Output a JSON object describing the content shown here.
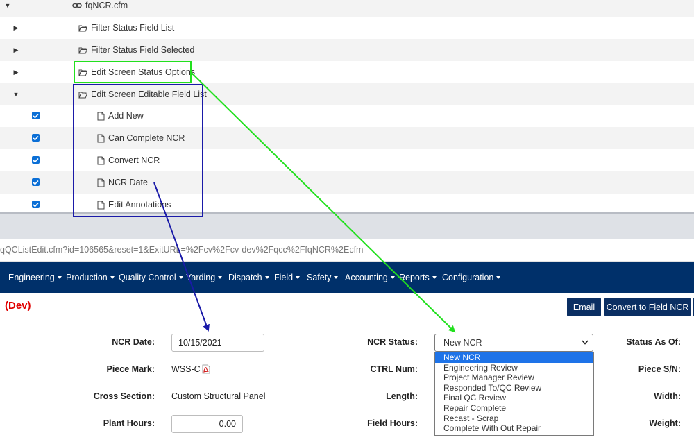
{
  "tree": {
    "root": {
      "label": "fqNCR.cfm",
      "icon": "link-icon"
    },
    "folders": [
      {
        "label": "Filter Status Field List",
        "icon": "folder-open-icon",
        "expanded": false
      },
      {
        "label": "Filter Status Field Selected",
        "icon": "folder-open-icon",
        "expanded": false
      },
      {
        "label": "Edit Screen Status Options",
        "icon": "folder-open-icon",
        "expanded": false
      },
      {
        "label": "Edit Screen Editable Field List",
        "icon": "folder-open-icon",
        "expanded": true
      }
    ],
    "files": [
      {
        "label": "Add New",
        "icon": "file-icon",
        "checked": true
      },
      {
        "label": "Can Complete NCR",
        "icon": "file-icon",
        "checked": true
      },
      {
        "label": "Convert NCR",
        "icon": "file-icon",
        "checked": true
      },
      {
        "label": "NCR Date",
        "icon": "file-icon",
        "checked": true
      },
      {
        "label": "Edit Annotations",
        "icon": "file-icon",
        "checked": true
      }
    ]
  },
  "browser": {
    "url": "qQCListEdit.cfm?id=106565&reset=1&ExitURL=%2Fcv%2Fcv-dev%2Fqcc%2FfqNCR%2Ecfm"
  },
  "nav": {
    "items": [
      {
        "label": "Engineering"
      },
      {
        "label": "Production"
      },
      {
        "label": "Quality Control"
      },
      {
        "label": "Yarding"
      },
      {
        "label": "Dispatch"
      },
      {
        "label": "Field"
      },
      {
        "label": "Safety"
      },
      {
        "label": "Accounting"
      },
      {
        "label": "Reports"
      },
      {
        "label": "Configuration"
      }
    ]
  },
  "page": {
    "env_label": "(Dev)",
    "buttons": {
      "email": "Email",
      "convert": "Convert to Field NCR"
    }
  },
  "form": {
    "ncr_date": {
      "label": "NCR Date:",
      "value": "10/15/2021"
    },
    "piece_mark": {
      "label": "Piece Mark:",
      "value": "WSS-C",
      "icon": "pdf-icon"
    },
    "cross_section": {
      "label": "Cross Section:",
      "value": "Custom Structural Panel"
    },
    "plant_hours": {
      "label": "Plant Hours:",
      "value": "0.00"
    },
    "ncr_status": {
      "label": "NCR Status:",
      "selected": "New NCR",
      "options": [
        "New NCR",
        "Engineering Review",
        "Project Manager Review",
        "Responded To/QC Review",
        "Final QC Review",
        "Repair Complete",
        "Recast - Scrap",
        "Complete With Out Repair"
      ]
    },
    "ctrl_num": {
      "label": "CTRL Num:"
    },
    "length": {
      "label": "Length:"
    },
    "field_hours": {
      "label": "Field Hours:"
    },
    "status_as_of": {
      "label": "Status As Of:"
    },
    "piece_sn": {
      "label": "Piece S/N:"
    },
    "width": {
      "label": "Width:"
    },
    "weight": {
      "label": "Weight:"
    }
  },
  "annotations": {
    "green": "#22e01e",
    "blue": "#1a1aa8"
  }
}
